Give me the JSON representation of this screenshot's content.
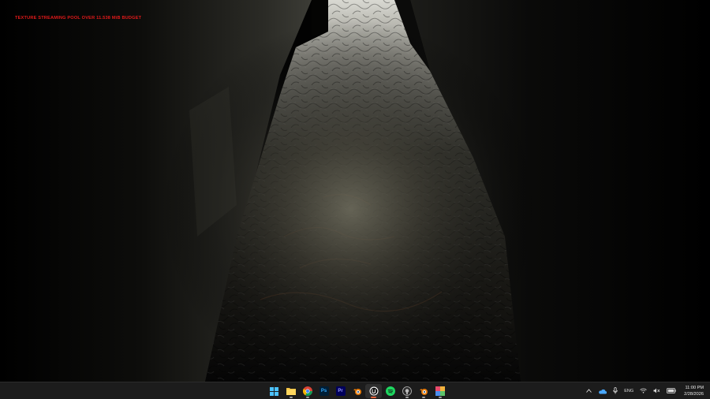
{
  "viewport": {
    "debug_message": "TEXTURE STREAMING POOL OVER 11.538 MiB BUDGET"
  },
  "taskbar": {
    "apps": [
      {
        "name": "start",
        "icon": "windows-start-icon",
        "running": false,
        "label": ""
      },
      {
        "name": "file-explorer",
        "icon": "folder-icon",
        "running": true,
        "label": ""
      },
      {
        "name": "chrome",
        "icon": "chrome-icon",
        "running": true,
        "label": ""
      },
      {
        "name": "photoshop",
        "icon": "photoshop-icon",
        "running": false,
        "label": "Ps"
      },
      {
        "name": "premiere",
        "icon": "premiere-icon",
        "running": false,
        "label": "Pr"
      },
      {
        "name": "blender",
        "icon": "blender-icon",
        "running": false,
        "label": ""
      },
      {
        "name": "unreal-engine",
        "icon": "unreal-engine-icon",
        "running": true,
        "active": true,
        "label": ""
      },
      {
        "name": "spotify",
        "icon": "spotify-icon",
        "running": false,
        "label": ""
      },
      {
        "name": "github",
        "icon": "github-icon",
        "running": true,
        "label": ""
      },
      {
        "name": "blender-2",
        "icon": "blender-icon",
        "running": true,
        "label": ""
      },
      {
        "name": "paint-app",
        "icon": "paint-app-icon",
        "running": true,
        "label": ""
      }
    ],
    "tray": {
      "language": "ENG",
      "time": "11:00 PM",
      "date": "2/28/2026"
    }
  },
  "colors": {
    "debug_text": "#e21a1a",
    "taskbar_bg": "#1c1c1c",
    "active_indicator": "#e0613b"
  }
}
